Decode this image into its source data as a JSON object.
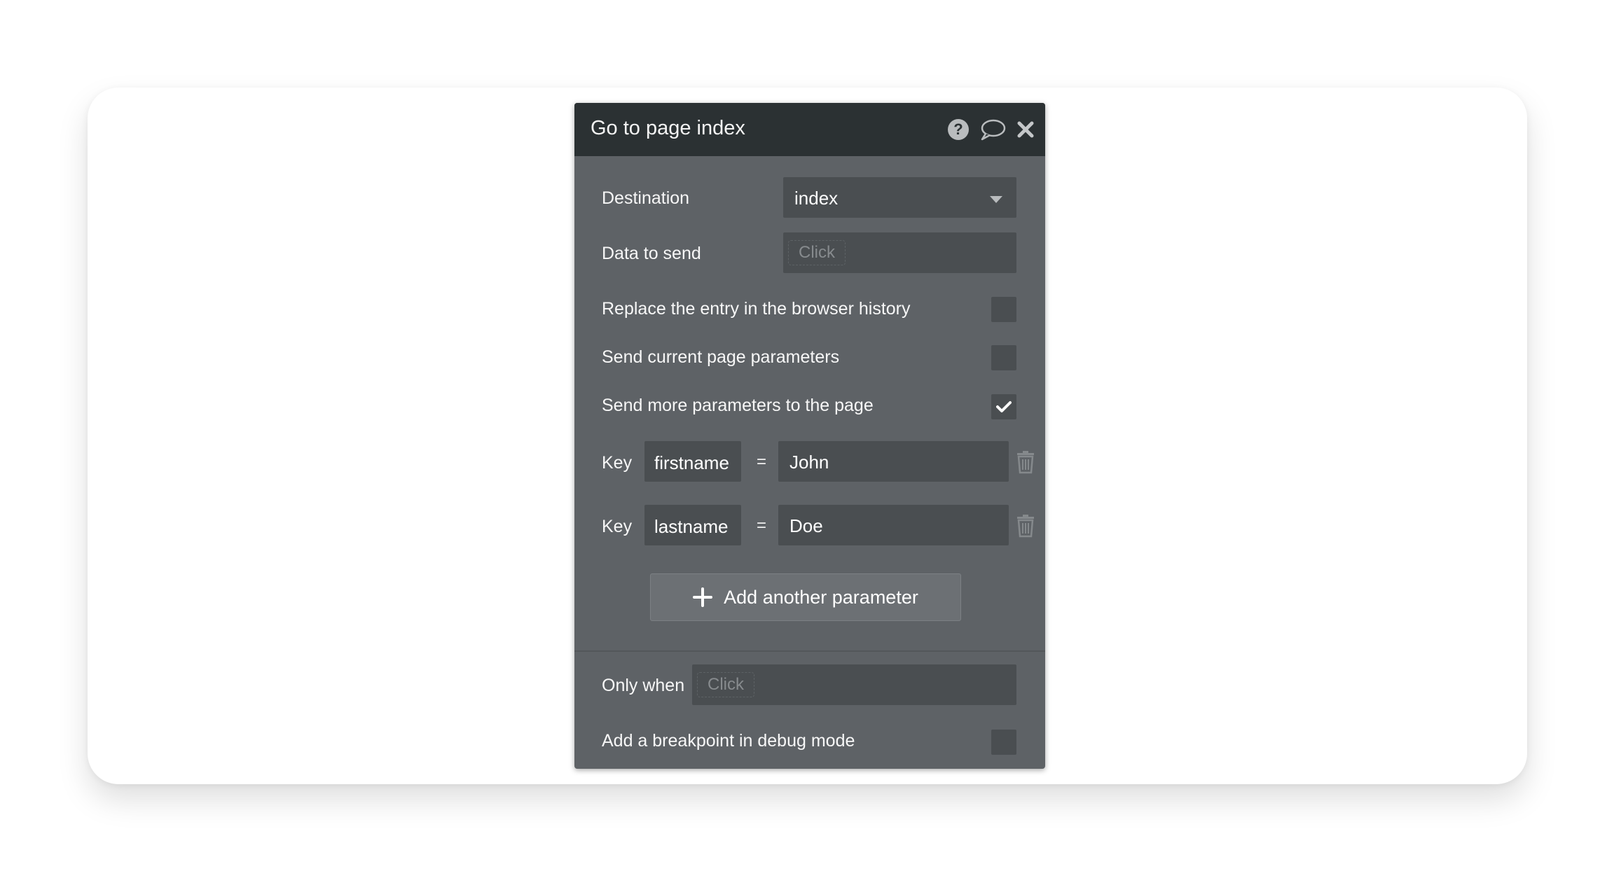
{
  "dialog": {
    "title": "Go to page index",
    "header_icons": [
      "help-icon",
      "comment-icon",
      "close-icon"
    ]
  },
  "destination": {
    "label": "Destination",
    "value": "index"
  },
  "data_to_send": {
    "label": "Data to send",
    "placeholder": "Click"
  },
  "options": {
    "replace_history": {
      "label": "Replace the entry in the browser history",
      "checked": false
    },
    "send_current_params": {
      "label": "Send current page parameters",
      "checked": false
    },
    "send_more_params": {
      "label": "Send more parameters to the page",
      "checked": true
    }
  },
  "parameters": [
    {
      "key_label": "Key",
      "key": "firstname",
      "equals": "=",
      "value": "John"
    },
    {
      "key_label": "Key",
      "key": "lastname",
      "equals": "=",
      "value": "Doe"
    }
  ],
  "add_parameter": {
    "label": "Add another parameter"
  },
  "only_when": {
    "label": "Only when",
    "placeholder": "Click"
  },
  "breakpoint": {
    "label": "Add a breakpoint in debug mode",
    "checked": false
  },
  "colors": {
    "header_bg": "#2b3133",
    "panel_bg": "#5e6266",
    "field_bg": "#4a4e51"
  }
}
